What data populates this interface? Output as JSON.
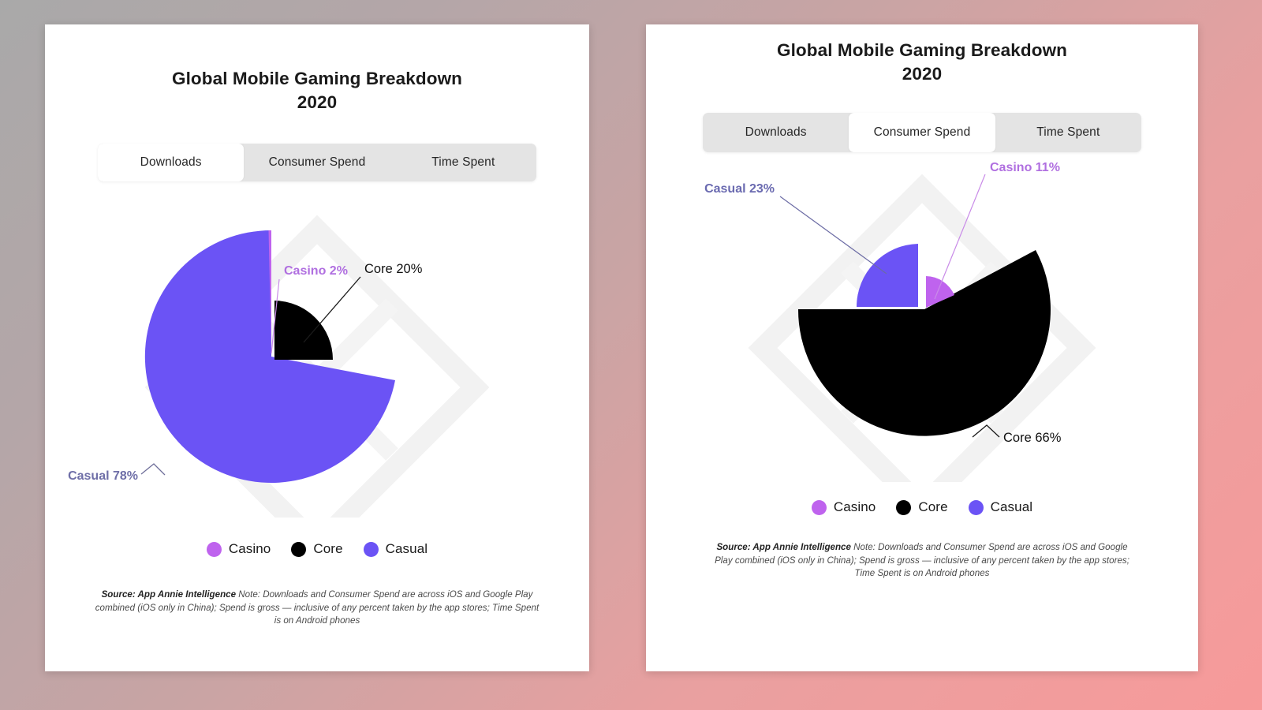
{
  "background": {
    "gradient_from": "#a9a9a9",
    "gradient_to": "#f79a9a"
  },
  "colors": {
    "casino": "#bf63ee",
    "core": "#000000",
    "casual": "#6b53f5",
    "tab_bar": "#e4e4e4",
    "tab_active": "#ffffff",
    "card": "#ffffff"
  },
  "panels": [
    {
      "id": "downloads-panel",
      "title": "Global Mobile Gaming Breakdown\n2020",
      "tabs": [
        {
          "label": "Downloads",
          "active": true
        },
        {
          "label": "Consumer Spend",
          "active": false
        },
        {
          "label": "Time Spent",
          "active": false
        }
      ],
      "legend": [
        {
          "label": "Casino",
          "color": "#bf63ee"
        },
        {
          "label": "Core",
          "color": "#000000"
        },
        {
          "label": "Casual",
          "color": "#6b53f5"
        }
      ],
      "source": {
        "bold": "Source: App Annie Intelligence",
        "text": " Note: Downloads and Consumer Spend are across iOS and Google Play combined (iOS only in China); Spend is gross — inclusive of any percent taken by the app stores; Time Spent is on Android phones"
      },
      "chart_data": {
        "type": "pie",
        "title": "Global Mobile Gaming Breakdown 2020",
        "metric": "Downloads",
        "categories": [
          "Casino",
          "Core",
          "Casual"
        ],
        "values": [
          2,
          20,
          78
        ],
        "labels": [
          "Casino 2%",
          "Core 20%",
          "Casual 78%"
        ],
        "colors": [
          "#bf63ee",
          "#000000",
          "#6b53f5"
        ],
        "exploded": [
          "Core"
        ],
        "legend_position": "bottom",
        "units": "percent"
      }
    },
    {
      "id": "consumer-spend-panel",
      "title": "Global Mobile Gaming Breakdown\n2020",
      "tabs": [
        {
          "label": "Downloads",
          "active": false
        },
        {
          "label": "Consumer Spend",
          "active": true
        },
        {
          "label": "Time Spent",
          "active": false
        }
      ],
      "legend": [
        {
          "label": "Casino",
          "color": "#bf63ee"
        },
        {
          "label": "Core",
          "color": "#000000"
        },
        {
          "label": "Casual",
          "color": "#6b53f5"
        }
      ],
      "source": {
        "bold": "Source: App Annie Intelligence",
        "text": " Note: Downloads and Consumer Spend are across iOS and Google Play combined (iOS only in China); Spend is gross — inclusive of any percent taken by the app stores; Time Spent is on Android phones"
      },
      "chart_data": {
        "type": "pie",
        "title": "Global Mobile Gaming Breakdown 2020",
        "metric": "Consumer Spend",
        "categories": [
          "Casino",
          "Core",
          "Casual"
        ],
        "values": [
          11,
          66,
          23
        ],
        "labels": [
          "Casino 11%",
          "Core 66%",
          "Casual 23%"
        ],
        "colors": [
          "#bf63ee",
          "#000000",
          "#6b53f5"
        ],
        "exploded": [
          "Casino",
          "Casual"
        ],
        "legend_position": "bottom",
        "units": "percent"
      }
    }
  ]
}
